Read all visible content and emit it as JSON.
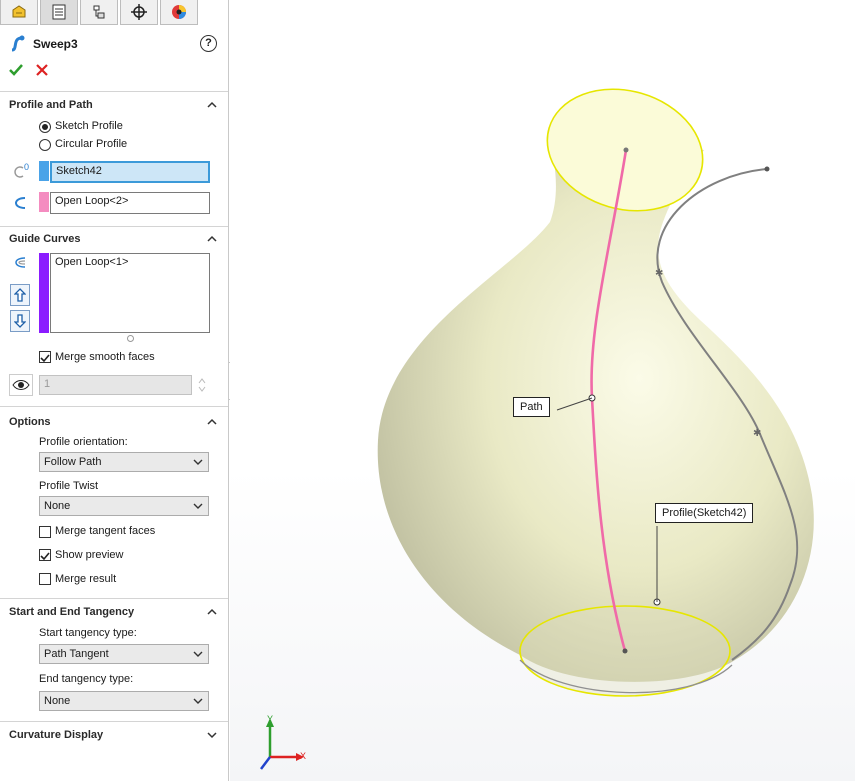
{
  "panel": {
    "feature_title": "Sweep3",
    "help": "?",
    "profile_and_path": {
      "title": "Profile and Path",
      "option_sketch_profile": "Sketch Profile",
      "option_circular_profile": "Circular Profile",
      "profile_value": "Sketch42",
      "path_value": "Open Loop<2>",
      "profile_color": "#4aa3e8",
      "path_color": "#f48cc0"
    },
    "guide_curves": {
      "title": "Guide Curves",
      "items": [
        "Open Loop<1>"
      ],
      "guide_color": "#8b1cff",
      "merge_smooth_label": "Merge smooth faces",
      "spin_value": "1"
    },
    "options": {
      "title": "Options",
      "profile_orientation_label": "Profile orientation:",
      "profile_orientation_value": "Follow Path",
      "profile_twist_label": "Profile Twist",
      "profile_twist_value": "None",
      "merge_tangent_label": "Merge tangent faces",
      "show_preview_label": "Show preview",
      "merge_result_label": "Merge result"
    },
    "tangency": {
      "title": "Start and End Tangency",
      "start_label": "Start tangency type:",
      "start_value": "Path Tangent",
      "end_label": "End tangency type:",
      "end_value": "None"
    },
    "curvature": {
      "title": "Curvature Display"
    }
  },
  "viewport": {
    "callout_path": "Path",
    "callout_profile": "Profile(Sketch42)",
    "triad_y": "Y",
    "triad_x": "X"
  }
}
